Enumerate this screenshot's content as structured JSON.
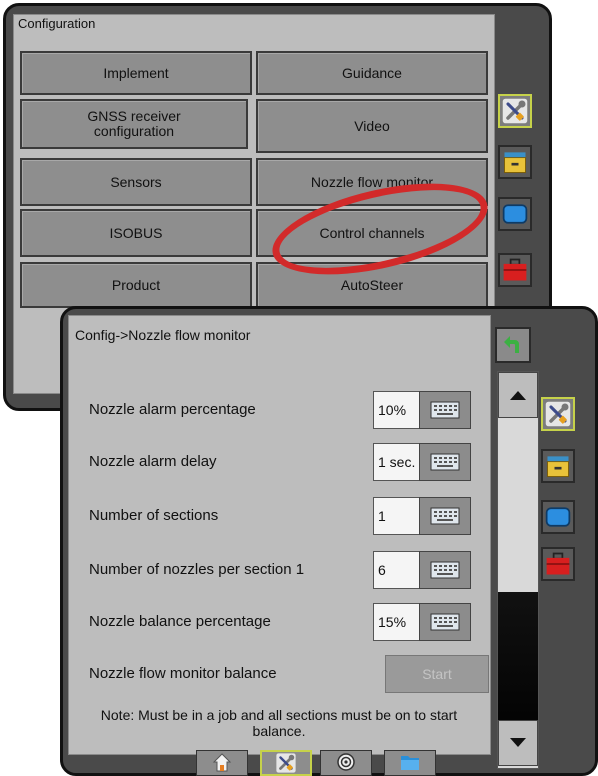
{
  "config_screen": {
    "title": "Configuration",
    "buttons": [
      {
        "label": "Implement"
      },
      {
        "label": "Guidance"
      },
      {
        "label": "GNSS receiver configuration"
      },
      {
        "label": "Video"
      },
      {
        "label": "Sensors"
      },
      {
        "label": "Nozzle flow monitor"
      },
      {
        "label": "ISOBUS"
      },
      {
        "label": "Control channels"
      },
      {
        "label": "Product"
      },
      {
        "label": "AutoSteer"
      }
    ]
  },
  "nozzle_screen": {
    "title": "Config->Nozzle flow monitor",
    "rows": [
      {
        "label": "Nozzle alarm percentage",
        "value": "10%"
      },
      {
        "label": "Nozzle alarm delay",
        "value": "1 sec."
      },
      {
        "label": "Number of sections",
        "value": "1"
      },
      {
        "label": "Number of nozzles per section 1",
        "value": "6"
      },
      {
        "label": "Nozzle balance percentage",
        "value": "15%"
      }
    ],
    "balance": {
      "label": "Nozzle flow monitor balance",
      "button": "Start"
    },
    "note": "Note: Must be in a job and all sections must be on to start balance."
  },
  "icons": {
    "side_tabs": [
      "tools-icon",
      "drawer-icon",
      "screen-icon",
      "toolbox-icon"
    ],
    "back": "back-arrow-icon",
    "keyboard": "keyboard-icon",
    "bottom_nav": [
      "home-icon",
      "tools-icon",
      "target-icon",
      "folder-icon"
    ]
  },
  "colors": {
    "active_border": "#c6d24a",
    "highlight_ellipse": "#d22a2a",
    "back_button": "#3cb043"
  }
}
